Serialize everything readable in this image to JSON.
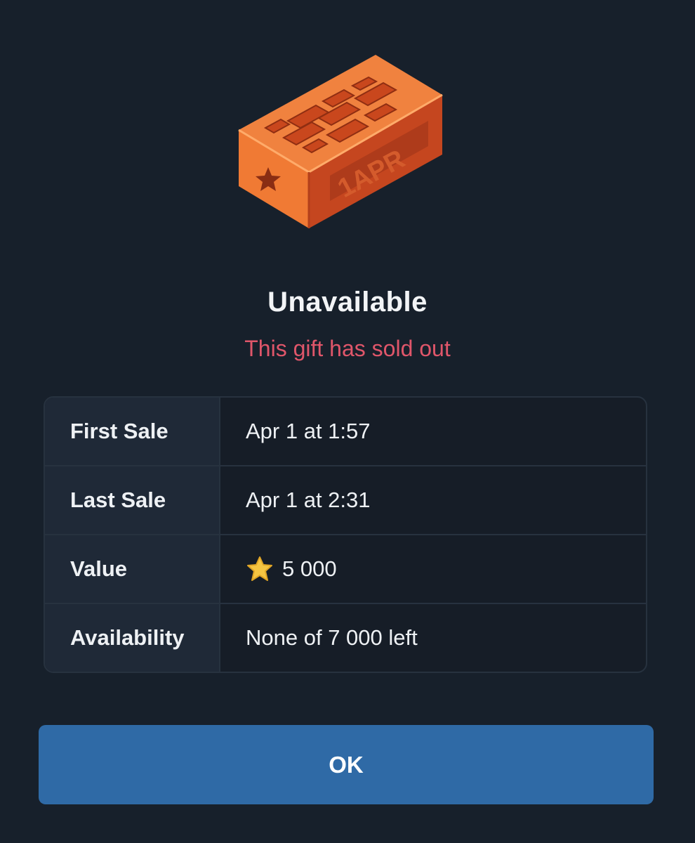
{
  "gift": {
    "image_icon": "brick-gift-icon",
    "stamp_text": "1APR"
  },
  "dialog": {
    "title": "Unavailable",
    "subtitle": "This gift has sold out",
    "subtitle_color": "#e0566a"
  },
  "details": [
    {
      "label": "First Sale",
      "value": "Apr 1 at 1:57"
    },
    {
      "label": "Last Sale",
      "value": "Apr 1 at 2:31"
    },
    {
      "label": "Value",
      "value": "5 000",
      "icon": "star-icon"
    },
    {
      "label": "Availability",
      "value": "None of 7 000 left"
    }
  ],
  "ok_button": {
    "label": "OK",
    "color": "#2f6aa6"
  }
}
